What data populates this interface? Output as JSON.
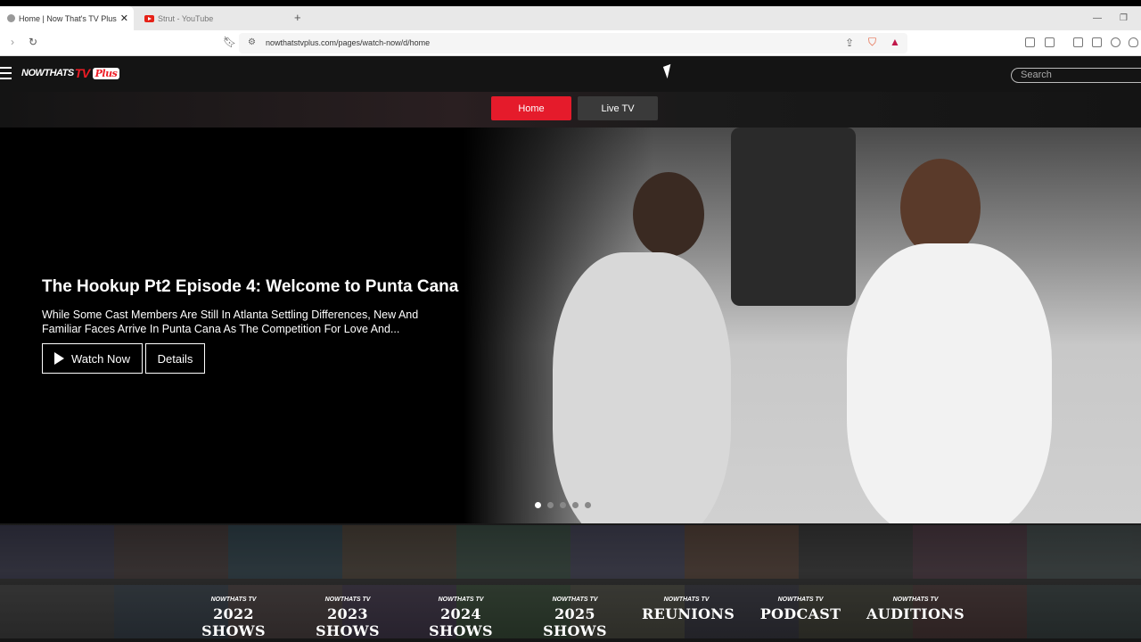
{
  "browser": {
    "tabs": [
      {
        "title": "Home | Now That's TV Plus",
        "active": true
      },
      {
        "title": "Strut - YouTube",
        "active": false
      }
    ],
    "url": "nowthatstvplus.com/pages/watch-now/d/home"
  },
  "header": {
    "logo_now": "NOWTHATS",
    "logo_tv": "TV",
    "logo_plus": "Plus",
    "search_placeholder": "Search"
  },
  "nav": {
    "home": "Home",
    "live_tv": "Live TV"
  },
  "hero": {
    "title": "The Hookup Pt2 Episode 4: Welcome to Punta Cana",
    "description": "While Some Cast Members Are Still In Atlanta Settling Differences, New And Familiar Faces Arrive In Punta Cana As The Competition For Love And...",
    "watch_label": "Watch Now",
    "details_label": "Details",
    "slides": 5,
    "active_slide": 1
  },
  "shows": {
    "brand": "NOWTHATS TV",
    "items": [
      "2022 SHOWS",
      "2023 SHOWS",
      "2024 SHOWS",
      "2025 SHOWS",
      "REUNIONS",
      "PODCAST",
      "AUDITIONS"
    ]
  },
  "colors": {
    "accent_red": "#e51b2b",
    "live_btn": "#3a3a3a"
  }
}
